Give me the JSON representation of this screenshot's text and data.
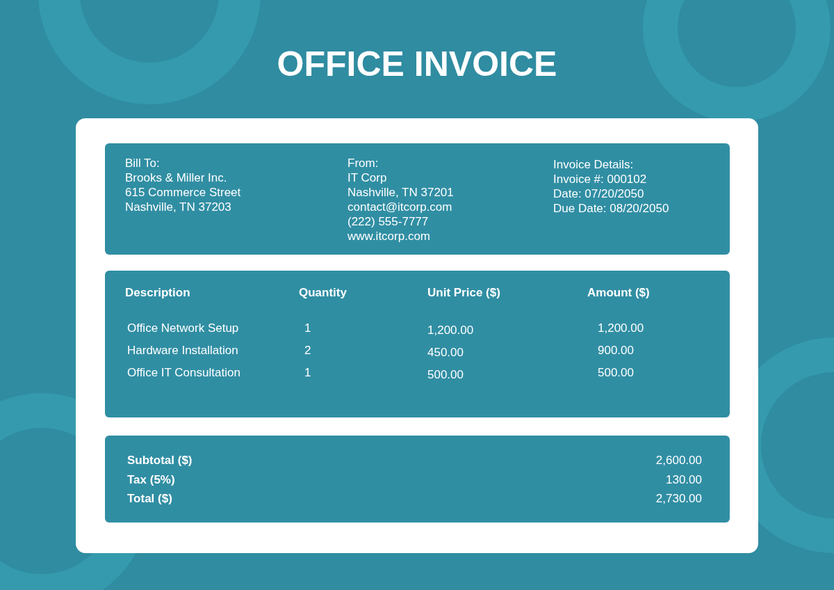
{
  "title": "OFFICE INVOICE",
  "parties": [
    {
      "heading": "Bill To:",
      "lines": [
        "Brooks & Miller Inc.",
        "615 Commerce Street",
        "Nashville, TN 37203"
      ]
    },
    {
      "heading": "From:",
      "lines": [
        "IT Corp",
        "Nashville, TN 37201",
        "contact@itcorp.com",
        "(222) 555-7777",
        "www.itcorp.com"
      ]
    },
    {
      "heading": "Invoice Details:",
      "lines": [
        "Invoice #: 000102",
        "Date: 07/20/2050",
        "Due Date: 08/20/2050"
      ]
    }
  ],
  "table": {
    "columns": [
      "Description",
      "Quantity",
      "Unit Price ($)",
      "Amount ($)"
    ],
    "rows": [
      [
        "Office Network Setup",
        "1",
        "1,200.00",
        "1,200.00"
      ],
      [
        "Hardware Installation",
        "2",
        "450.00",
        "900.00"
      ],
      [
        "Office IT Consultation",
        "1",
        "500.00",
        "500.00"
      ]
    ]
  },
  "totals": [
    {
      "label": "Subtotal ($)",
      "value": "2,600.00"
    },
    {
      "label": "Tax (5%)",
      "value": "130.00"
    },
    {
      "label": "Total ($)",
      "value": "2,730.00"
    }
  ]
}
